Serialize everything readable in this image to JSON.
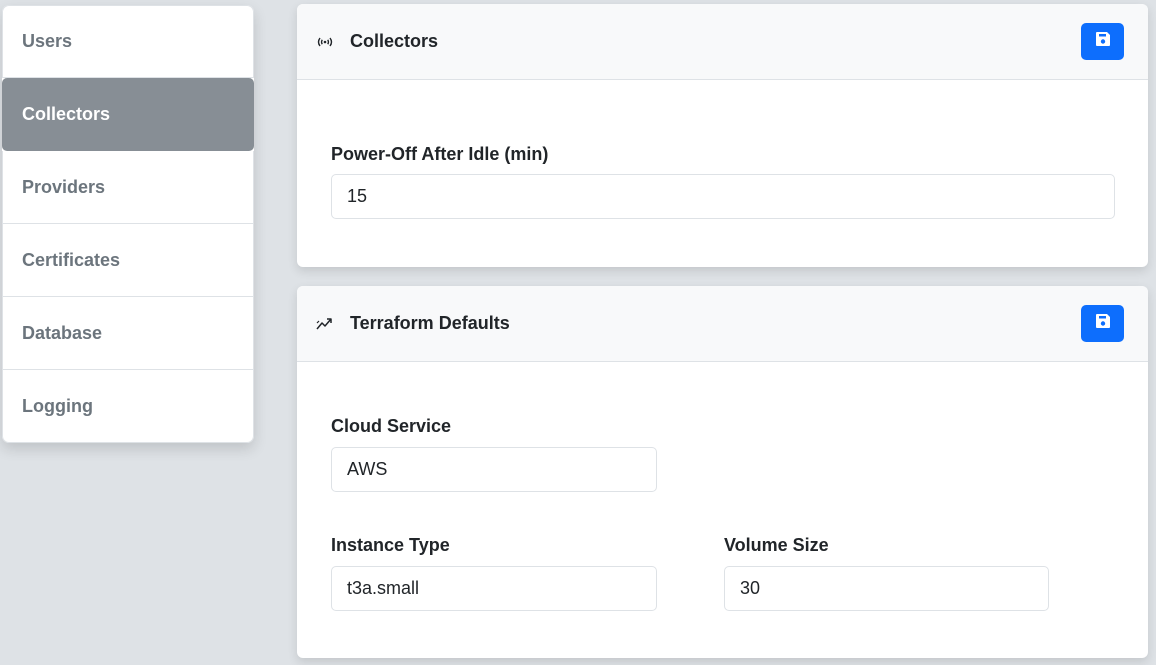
{
  "sidebar": {
    "items": [
      {
        "label": "Users",
        "active": false
      },
      {
        "label": "Collectors",
        "active": true
      },
      {
        "label": "Providers",
        "active": false
      },
      {
        "label": "Certificates",
        "active": false
      },
      {
        "label": "Database",
        "active": false
      },
      {
        "label": "Logging",
        "active": false
      }
    ]
  },
  "collectors_card": {
    "title": "Collectors",
    "icon": "broadcast-icon",
    "save_icon": "floppy-disk-icon",
    "fields": {
      "power_off_label": "Power-Off After Idle (min)",
      "power_off_value": "15"
    }
  },
  "terraform_card": {
    "title": "Terraform Defaults",
    "icon": "graph-trend-icon",
    "save_icon": "floppy-disk-icon",
    "fields": {
      "cloud_service_label": "Cloud Service",
      "cloud_service_value": "AWS",
      "instance_type_label": "Instance Type",
      "instance_type_value": "t3a.small",
      "volume_size_label": "Volume Size",
      "volume_size_value": "30"
    }
  },
  "colors": {
    "primary": "#0d6efd",
    "active_nav": "#878e95",
    "background": "#dee2e6"
  }
}
